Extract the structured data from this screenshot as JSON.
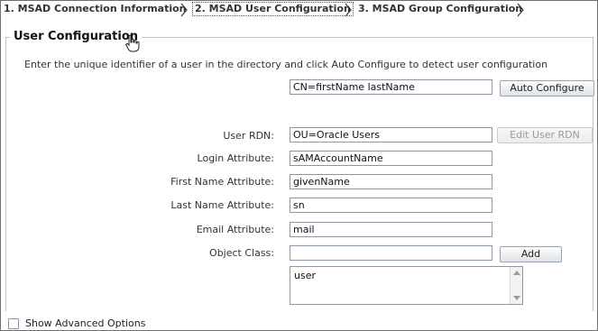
{
  "wizard": {
    "steps": [
      {
        "label": "1. MSAD Connection Information",
        "active": false
      },
      {
        "label": "2. MSAD User Configuration",
        "active": true
      },
      {
        "label": "3. MSAD Group Configuration",
        "active": false
      }
    ]
  },
  "section": {
    "title": "User Configuration",
    "instructions": "Enter the unique identifier of a user in the directory and click Auto Configure to detect user configuration"
  },
  "identifier": {
    "value": "CN=firstName lastName",
    "auto_configure_label": "Auto Configure"
  },
  "fields": {
    "user_rdn": {
      "label": "User RDN:",
      "value": "OU=Oracle Users",
      "button_label": "Edit User RDN"
    },
    "login_attribute": {
      "label": "Login Attribute:",
      "value": "sAMAccountName"
    },
    "first_name_attribute": {
      "label": "First Name Attribute:",
      "value": "givenName"
    },
    "last_name_attribute": {
      "label": "Last Name Attribute:",
      "value": "sn"
    },
    "email_attribute": {
      "label": "Email Attribute:",
      "value": "mail"
    },
    "object_class": {
      "label": "Object Class:",
      "value": "",
      "add_label": "Add",
      "list": [
        "user"
      ]
    }
  },
  "advanced": {
    "label": "Show Advanced Options",
    "checked": false
  },
  "colors": {
    "border": "#b9c3cf",
    "field_border": "#8a97a6",
    "disabled_text": "#9a9a9a"
  },
  "icons": [
    "chevron-right-icon",
    "hand-cursor-icon",
    "scroll-up-icon",
    "scroll-down-icon"
  ]
}
